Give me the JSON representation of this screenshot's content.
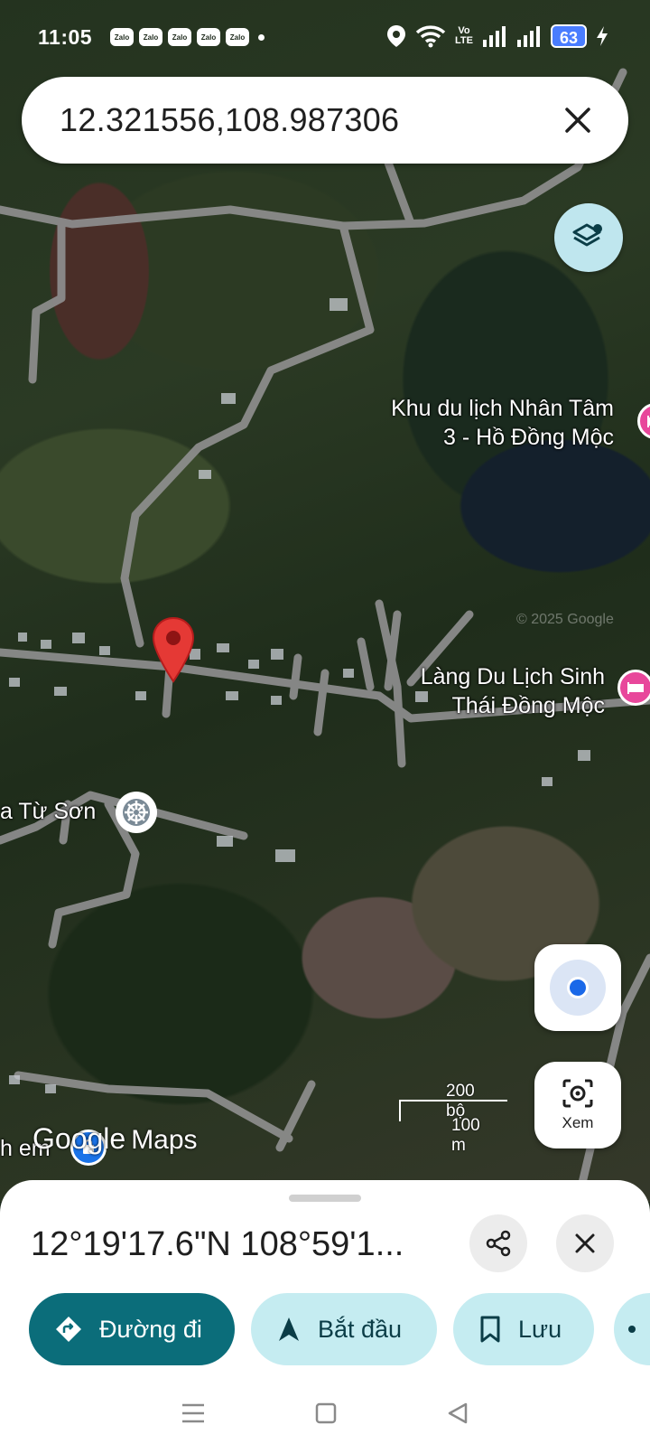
{
  "status_bar": {
    "time": "11:05",
    "notifications": [
      "Zalo",
      "Zalo",
      "Zalo",
      "Zalo",
      "Zalo"
    ],
    "network_top": "Vo",
    "network_bottom": "LTE",
    "battery": "63",
    "icons": [
      "location-icon",
      "wifi-icon",
      "signal-icon",
      "signal-icon",
      "charging-icon"
    ]
  },
  "search": {
    "query": "12.321556,108.987306",
    "clear_icon": "close-icon"
  },
  "map": {
    "labels": [
      {
        "text": "Khu du lịch Nhân Tâm\n3 - Hồ Đồng Mộc",
        "icon": "hotel-icon"
      },
      {
        "text": "Làng Du Lịch Sinh\nThái Đồng Mộc",
        "icon": "hotel-icon"
      },
      {
        "text": "a Từ Sơn",
        "icon": "temple-icon"
      },
      {
        "text": "h em",
        "icon": "shopping-icon"
      }
    ],
    "copyright": "© 2025 Google",
    "scale_top": "200 bộ",
    "scale_bottom": "100 m",
    "logo_google": "Google",
    "logo_maps": "Maps",
    "controls": {
      "layers_icon": "layers-icon",
      "my_location_icon": "my-location-icon",
      "view_label": "Xem",
      "view_icon": "camera-icon"
    }
  },
  "sheet": {
    "title": "12°19'17.6\"N 108°59'1...",
    "share_icon": "share-icon",
    "close_icon": "close-icon",
    "actions": [
      {
        "label": "Đường đi",
        "icon": "directions-icon"
      },
      {
        "label": "Bắt đầu",
        "icon": "navigation-arrow-icon"
      },
      {
        "label": "Lưu",
        "icon": "bookmark-icon"
      }
    ]
  },
  "colors": {
    "primary": "#0b6d7a",
    "secondary_chip": "#c5ecf1",
    "pin_red": "#e53935",
    "poi_pink": "#e8479b",
    "location_blue": "#1a68e8"
  }
}
